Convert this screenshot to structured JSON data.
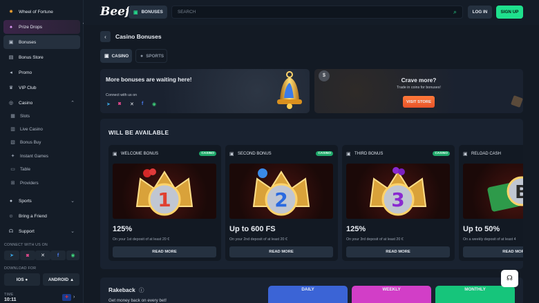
{
  "header": {
    "logo": "Beef",
    "bonuses_label": "BONUSES",
    "search_placeholder": "SEARCH",
    "login_label": "LOG IN",
    "signup_label": "SIGN UP"
  },
  "sidebar": {
    "wheel": "Wheel of Fortune",
    "prize": "Prize Drops",
    "bonuses": "Bonuses",
    "store": "Bonus Store",
    "promo": "Promo",
    "vip": "VIP Club",
    "casino": "Casino",
    "casino_items": [
      "Slots",
      "Live Casino",
      "Bonus Buy",
      "Instant Games",
      "Table",
      "Providers"
    ],
    "sports": "Sports",
    "friend": "Bring a Friend",
    "support": "Support",
    "connect_label": "CONNECT WITH US ON",
    "download_label": "DOWNLOAD FOR",
    "ios": "IOS",
    "android": "ANDROID",
    "time_label": "TIME",
    "time_value": "10:11"
  },
  "main": {
    "page_title": "Casino Bonuses",
    "tab_casino": "CASINO",
    "tab_sports": "SPORTS",
    "promo_title": "More bonuses are waiting here!",
    "promo_connect": "Connect with us on",
    "crave_title": "Crave more?",
    "crave_sub": "Trade in coins for bonuses!",
    "visit_label": "VISIT STORE",
    "available_title": "WILL BE AVAILABLE",
    "cards": [
      {
        "title": "WELCOME BONUS",
        "badge": "CASINO",
        "value": "125%",
        "desc": "On your 1st deposit of at least 20 €",
        "more": "READ MORE",
        "number": "1"
      },
      {
        "title": "SECOND BONUS",
        "badge": "CASINO",
        "value": "Up to 600 FS",
        "desc": "On your 2nd deposit of at least 20 €",
        "more": "READ MORE",
        "number": "2"
      },
      {
        "title": "THIRD BONUS",
        "badge": "CASINO",
        "value": "125%",
        "desc": "On your 3rd deposit of at least 20 €",
        "more": "READ MORE",
        "number": "3"
      },
      {
        "title": "RELOAD CASH",
        "badge": "",
        "value": "Up to 50%",
        "desc": "On a weekly deposit of at least 4",
        "more": "READ MORE",
        "number": "B"
      }
    ],
    "rakeback_title": "Rakeback",
    "rakeback_sub": "Get money back on every bet!",
    "periods": [
      "DAILY",
      "WEEKLY",
      "MONTHLY"
    ]
  },
  "colors": {
    "accent": "#1fe08d",
    "visit": "#ff6a33",
    "daily": "#4a7cf0",
    "weekly": "#e24ad6",
    "monthly": "#1fe08d"
  }
}
